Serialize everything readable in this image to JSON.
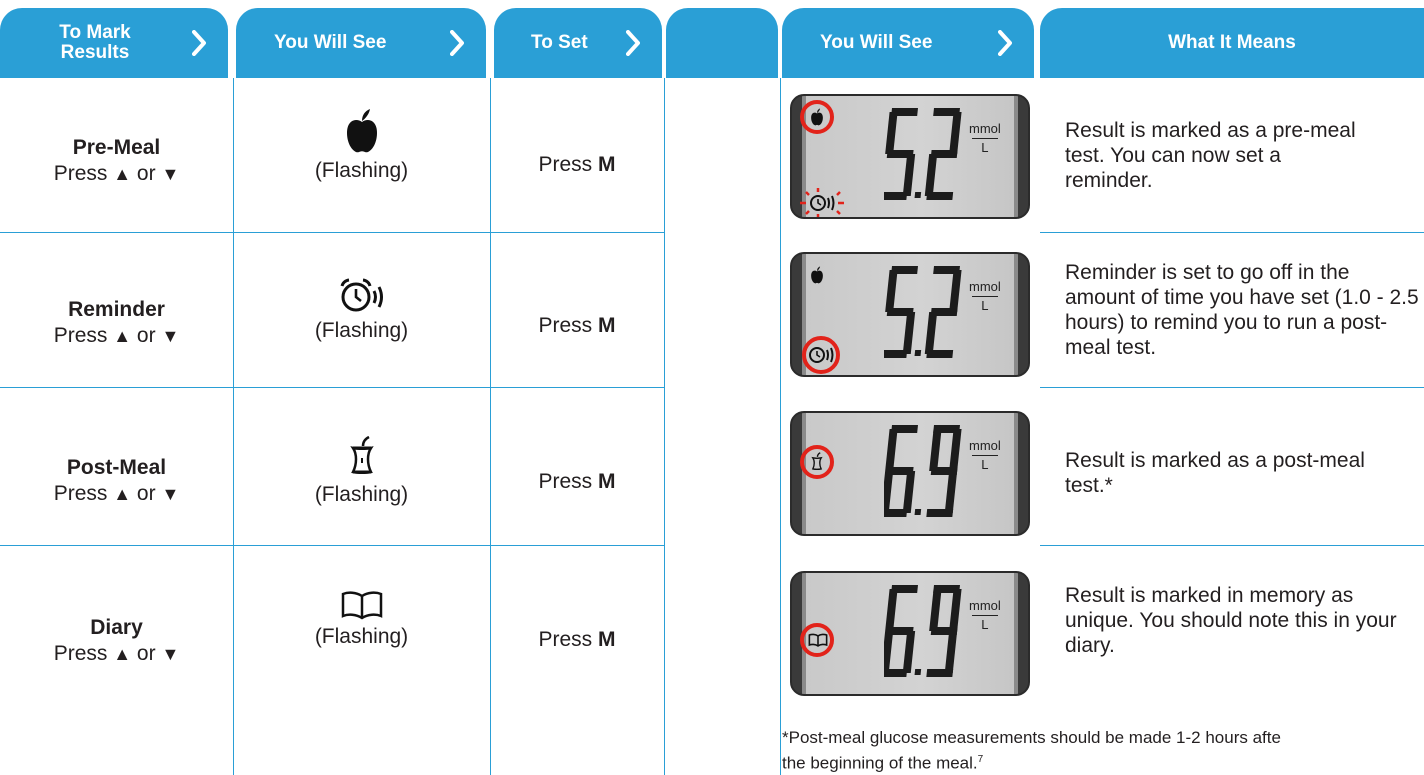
{
  "headers": {
    "mark": "To Mark Results",
    "see": "You Will See",
    "set": "To Set",
    "see2": "You Will See",
    "means": "What It Means"
  },
  "rows": [
    {
      "title": "Pre-Meal",
      "press_prefix": "Press",
      "press_or": "or",
      "icon": "apple-icon",
      "flashing": "(Flashing)",
      "set_prefix": "Press",
      "set_key": "M",
      "reading": "5.2",
      "unit_top": "mmol",
      "unit_bottom": "L",
      "meaning": "Result is marked as a pre-meal test. You can now set a reminder."
    },
    {
      "title": "Reminder",
      "press_prefix": "Press",
      "press_or": "or",
      "icon": "alarm-clock-icon",
      "flashing": "(Flashing)",
      "set_prefix": "Press",
      "set_key": "M",
      "reading": "5.2",
      "unit_top": "mmol",
      "unit_bottom": "L",
      "meaning": "Reminder is set to go off in the amount of time you have set (1.0 - 2.5 hours) to remind you to run a post-meal test."
    },
    {
      "title": "Post-Meal",
      "press_prefix": "Press",
      "press_or": "or",
      "icon": "apple-core-icon",
      "flashing": "(Flashing)",
      "set_prefix": "Press",
      "set_key": "M",
      "reading": "6.9",
      "unit_top": "mmol",
      "unit_bottom": "L",
      "meaning": "Result is marked as a post-meal test.*"
    },
    {
      "title": "Diary",
      "press_prefix": "Press",
      "press_or": "or",
      "icon": "book-icon",
      "flashing": "(Flashing)",
      "set_prefix": "Press",
      "set_key": "M",
      "reading": "6.9",
      "unit_top": "mmol",
      "unit_bottom": "L",
      "meaning": "Result is marked in memory as unique. You should note this in your diary."
    }
  ],
  "footnote": {
    "line1": "*Post-meal glucose measurements should be made 1-2 hours afte",
    "line2": " the beginning of the meal.",
    "ref": "7"
  },
  "colors": {
    "accent": "#2a9fd6",
    "highlight": "#e2231a"
  }
}
